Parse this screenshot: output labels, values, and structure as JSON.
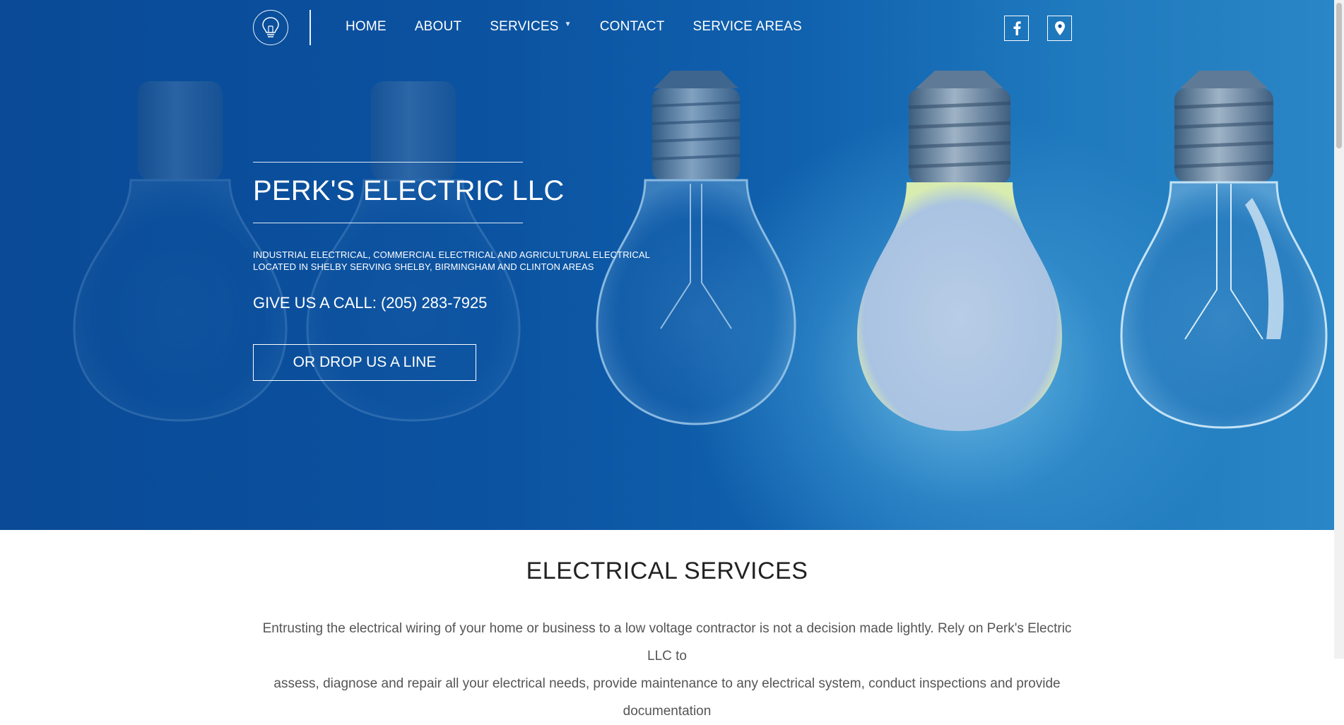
{
  "nav": {
    "items": [
      {
        "label": "HOME"
      },
      {
        "label": "ABOUT"
      },
      {
        "label": "SERVICES",
        "has_dropdown": true
      },
      {
        "label": "CONTACT"
      },
      {
        "label": "SERVICE AREAS"
      }
    ],
    "logo_icon": "lightbulb-icon",
    "social_icons": [
      "facebook-icon",
      "map-pin-icon"
    ]
  },
  "hero": {
    "title": "PERK'S ELECTRIC LLC",
    "tagline_line1": "INDUSTRIAL ELECTRICAL, COMMERCIAL ELECTRICAL AND AGRICULTURAL ELECTRICAL",
    "tagline_line2": "LOCATED IN SHELBY SERVING SHELBY, BIRMINGHAM AND CLINTON AREAS",
    "call_text": "GIVE US A CALL: (205) 283-7925",
    "cta_label": "OR DROP US A LINE"
  },
  "main": {
    "section_title": "ELECTRICAL SERVICES",
    "intro_line1": "Entrusting the electrical wiring of your home or business to a low voltage contractor is not a decision made lightly. Rely on Perk's Electric LLC to",
    "intro_line2": "assess, diagnose and repair all your electrical needs, provide maintenance to any electrical system, conduct inspections and provide documentation"
  },
  "colors": {
    "hero_blue": "#0b52a0",
    "hero_glow": "#78c8eb",
    "text_dark": "#222222",
    "text_body": "#555555"
  }
}
